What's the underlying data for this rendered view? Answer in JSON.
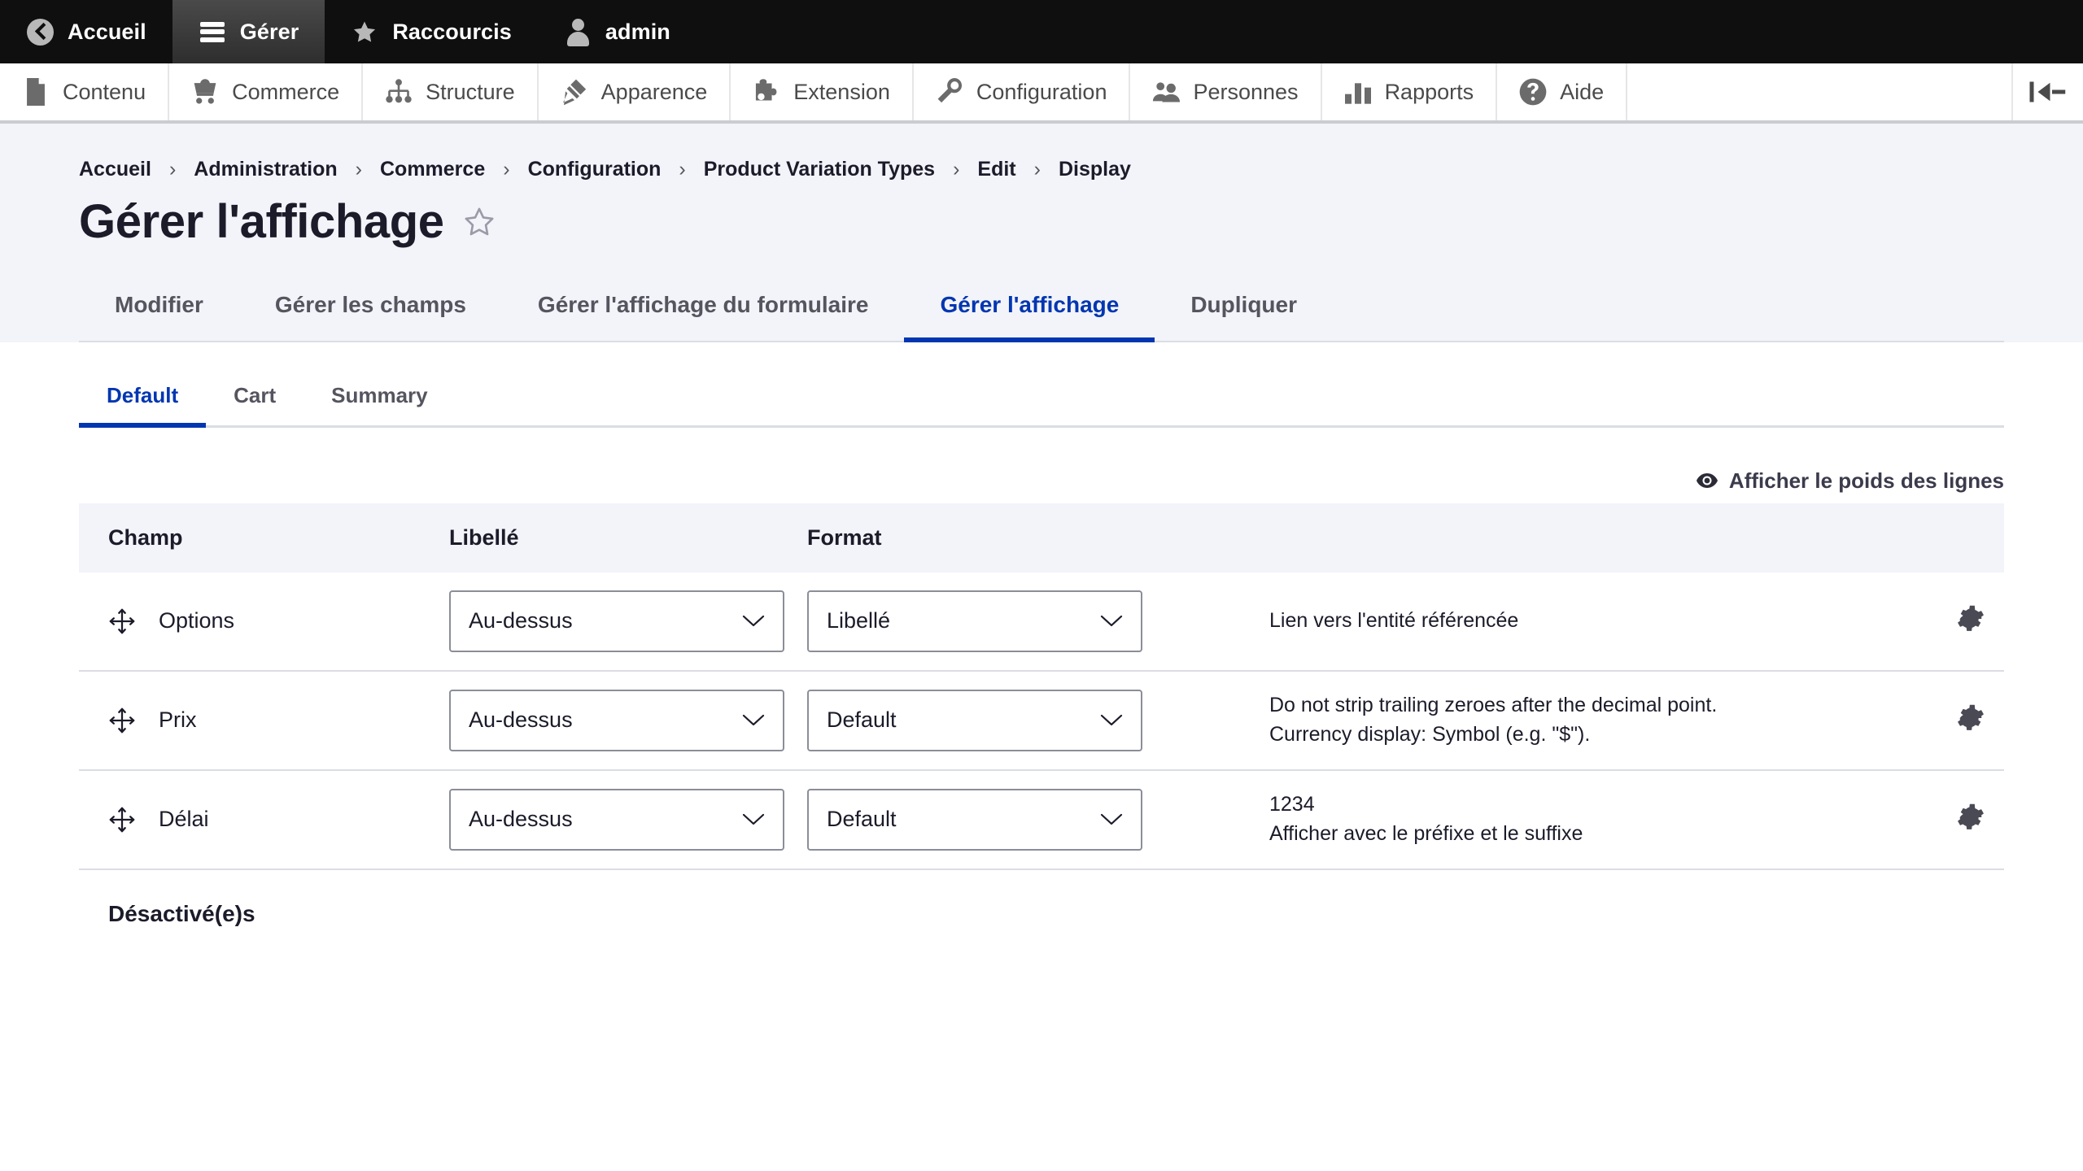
{
  "toolbar": {
    "tabs": [
      {
        "label": "Accueil",
        "icon": "back-circle-icon",
        "active": false
      },
      {
        "label": "Gérer",
        "icon": "hamburger-icon",
        "active": true
      },
      {
        "label": "Raccourcis",
        "icon": "star-icon",
        "active": false
      },
      {
        "label": "admin",
        "icon": "person-icon",
        "active": false
      }
    ]
  },
  "admin_menu": {
    "items": [
      {
        "label": "Contenu",
        "icon": "document-icon"
      },
      {
        "label": "Commerce",
        "icon": "shopping-cart-icon"
      },
      {
        "label": "Structure",
        "icon": "sitemap-icon"
      },
      {
        "label": "Apparence",
        "icon": "paintbrush-icon"
      },
      {
        "label": "Extension",
        "icon": "puzzle-piece-icon"
      },
      {
        "label": "Configuration",
        "icon": "wrench-icon"
      },
      {
        "label": "Personnes",
        "icon": "people-icon"
      },
      {
        "label": "Rapports",
        "icon": "bar-chart-icon"
      },
      {
        "label": "Aide",
        "icon": "question-circle-icon"
      }
    ],
    "collapse_icon": "collapse-panel-icon"
  },
  "breadcrumb": {
    "separator": "›",
    "items": [
      "Accueil",
      "Administration",
      "Commerce",
      "Configuration",
      "Product Variation Types",
      "Edit",
      "Display"
    ]
  },
  "page": {
    "title": "Gérer l'affichage",
    "favorite_icon": "star-outline-icon"
  },
  "primary_tabs": [
    {
      "label": "Modifier",
      "active": false
    },
    {
      "label": "Gérer les champs",
      "active": false
    },
    {
      "label": "Gérer l'affichage du formulaire",
      "active": false
    },
    {
      "label": "Gérer l'affichage",
      "active": true
    },
    {
      "label": "Dupliquer",
      "active": false
    }
  ],
  "view_modes": [
    {
      "label": "Default",
      "active": true
    },
    {
      "label": "Cart",
      "active": false
    },
    {
      "label": "Summary",
      "active": false
    }
  ],
  "row_weights_toggle": {
    "label": "Afficher le poids des lignes",
    "icon": "eye-icon"
  },
  "table": {
    "columns": [
      "Champ",
      "Libellé",
      "Format"
    ],
    "rows": [
      {
        "field": "Options",
        "drag_icon": "drag-move-icon",
        "label_select": "Au-dessus",
        "format_select": "Libellé",
        "summary": [
          "Lien vers l'entité référencée"
        ],
        "settings_icon": "gear-icon"
      },
      {
        "field": "Prix",
        "drag_icon": "drag-move-icon",
        "label_select": "Au-dessus",
        "format_select": "Default",
        "summary": [
          "Do not strip trailing zeroes after the decimal point.",
          "Currency display: Symbol (e.g. \"$\")."
        ],
        "settings_icon": "gear-icon"
      },
      {
        "field": "Délai",
        "drag_icon": "drag-move-icon",
        "label_select": "Au-dessus",
        "format_select": "Default",
        "summary": [
          "1234",
          "Afficher avec le préfixe et le suffixe"
        ],
        "settings_icon": "gear-icon"
      }
    ],
    "disabled_section_label": "Désactivé(e)s"
  },
  "colors": {
    "accent": "#0036b1",
    "toolbar_bg": "#0f0f0f",
    "header_bg": "#f3f4f9",
    "border": "#dcdde4",
    "text": "#1b1b2a"
  }
}
